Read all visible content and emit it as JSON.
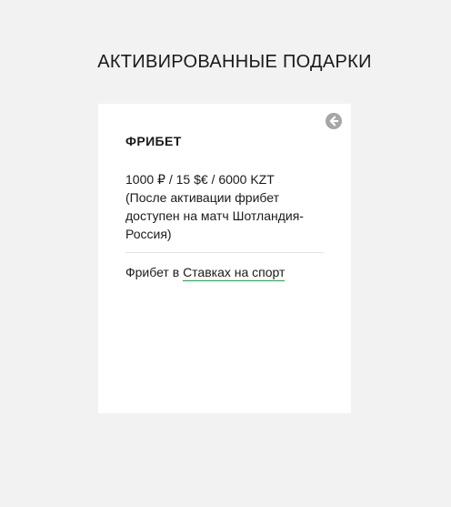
{
  "page": {
    "title": "АКТИВИРОВАННЫЕ ПОДАРКИ"
  },
  "card": {
    "title": "ФРИБЕТ",
    "amount": "1000 ₽ / 15 $€ / 6000 KZT",
    "note": "(После активации фрибет доступен на матч Шотландия-Россия)",
    "footer_prefix": "Фрибет в ",
    "footer_link": "Ставках на спорт",
    "back_icon": "circle-arrow-left-icon"
  },
  "colors": {
    "background": "#f2f2f2",
    "card": "#ffffff",
    "link_underline": "#1fa34a",
    "icon": "#a6a6a6"
  }
}
